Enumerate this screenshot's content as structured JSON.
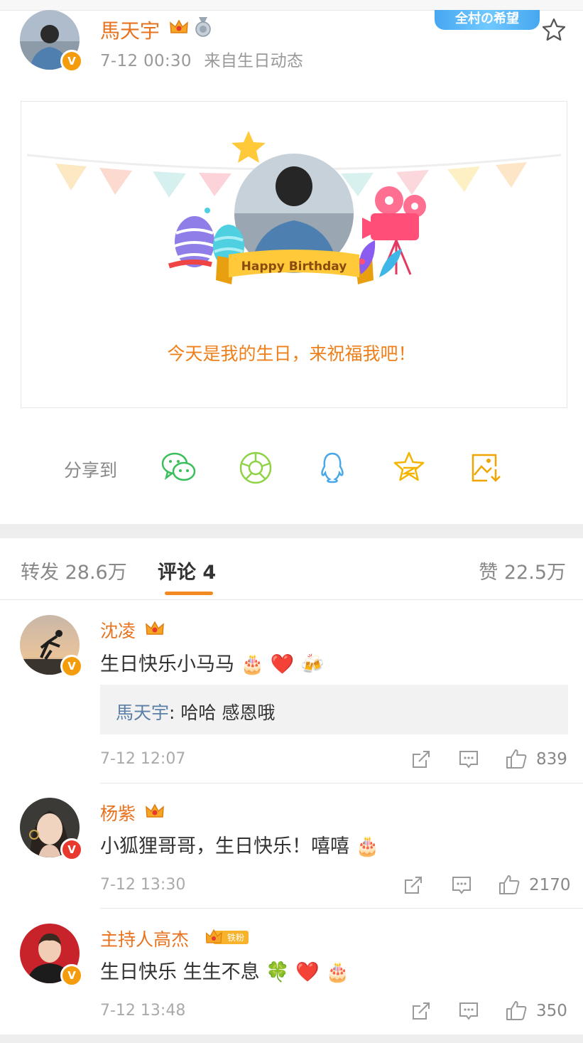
{
  "post": {
    "author_name": "馬天宇",
    "time": "7-12 00:30",
    "source": "来自生日动态",
    "card_label": "全村の希望",
    "birthday_banner": "Happy Birthday",
    "birthday_message": "今天是我的生日，来祝福我吧！",
    "favorite_icon": "star-outline-icon"
  },
  "share": {
    "label": "分享到",
    "targets": [
      "wechat",
      "moments",
      "qq",
      "qzone",
      "save-image"
    ]
  },
  "tabs": {
    "repost": "转发 28.6万",
    "comment": "评论 4",
    "like": "赞 22.5万"
  },
  "comments": [
    {
      "name": "沈凌",
      "text": "生日快乐小马马",
      "emojis": [
        "🎂",
        "❤️",
        "🍻"
      ],
      "reply_name": "馬天宇",
      "reply_text": ": 哈哈 感恩哦",
      "time": "7-12 12:07",
      "likes": "839"
    },
    {
      "name": "杨紫",
      "text": "小狐狸哥哥，生日快乐！嘻嘻",
      "emojis": [
        "🎂"
      ],
      "time": "7-12 13:30",
      "likes": "2170"
    },
    {
      "name": "主持人高杰",
      "badge": "铁粉",
      "text": "生日快乐 生生不息",
      "emojis": [
        "🍀",
        "❤️",
        "🎂"
      ],
      "time": "7-12 13:48",
      "likes": "350"
    }
  ],
  "colors": {
    "accent": "#e8731f",
    "verified": "#f59c0c",
    "reply_name": "#5b7fa6"
  }
}
